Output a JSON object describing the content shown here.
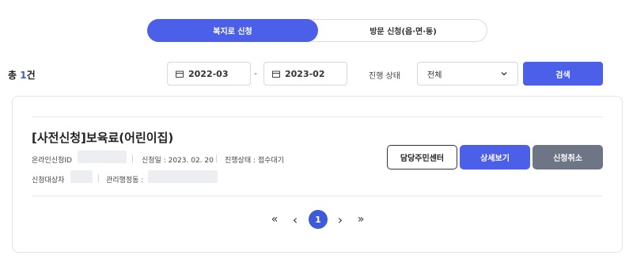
{
  "tabs": {
    "active_label": "복지로 신청",
    "inactive_label": "방문 신청(읍·면·동)"
  },
  "filter": {
    "total_prefix": "총 ",
    "total_count": "1",
    "total_suffix": "건",
    "start_date": "2022-03",
    "end_date": "2023-02",
    "range_sep": "-",
    "status_label": "진행 상태",
    "status_value": "전체",
    "search_label": "검색"
  },
  "item": {
    "title": "[사전신청]보육료(어린이집)",
    "online_id_label": "온라인신청ID",
    "apply_date": "신청일 : 2023. 02. 20",
    "progress": "진행상태 : 접수대기",
    "target_label": "신청대상자",
    "office_label": "관리행정동 :",
    "center_button": "담당주민센터",
    "detail_button": "상세보기",
    "cancel_button": "신청취소"
  },
  "pagination": {
    "first": "«",
    "prev": "‹",
    "current": "1",
    "next": "›",
    "last": "»"
  }
}
